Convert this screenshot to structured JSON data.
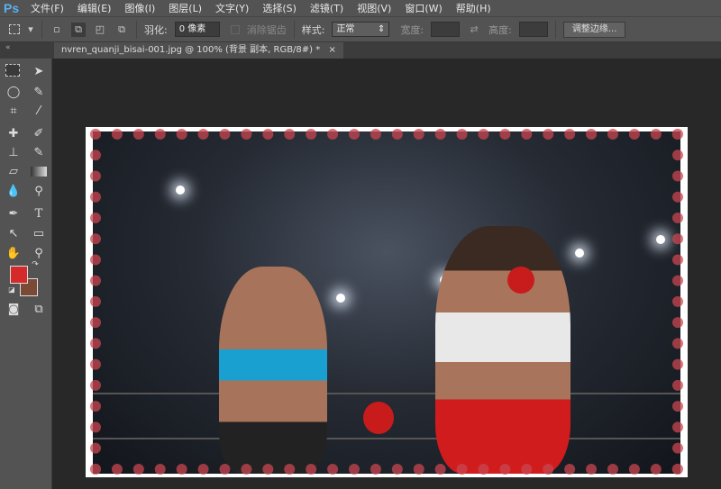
{
  "app": {
    "logo": "Ps"
  },
  "menu": [
    "文件(F)",
    "编辑(E)",
    "图像(I)",
    "图层(L)",
    "文字(Y)",
    "选择(S)",
    "滤镜(T)",
    "视图(V)",
    "窗口(W)",
    "帮助(H)"
  ],
  "options": {
    "feather_label": "羽化:",
    "feather_value": "0 像素",
    "antialias_label": "消除锯齿",
    "style_label": "样式:",
    "style_value": "正常",
    "width_label": "宽度:",
    "height_label": "高度:",
    "refine_edge": "调整边缘..."
  },
  "tab": {
    "title": "nvren_quanji_bisai-001.jpg @ 100% (背景 副本, RGB/8#) *",
    "close": "×"
  },
  "colors": {
    "foreground": "#d42a2a",
    "background": "#7a4a35"
  }
}
